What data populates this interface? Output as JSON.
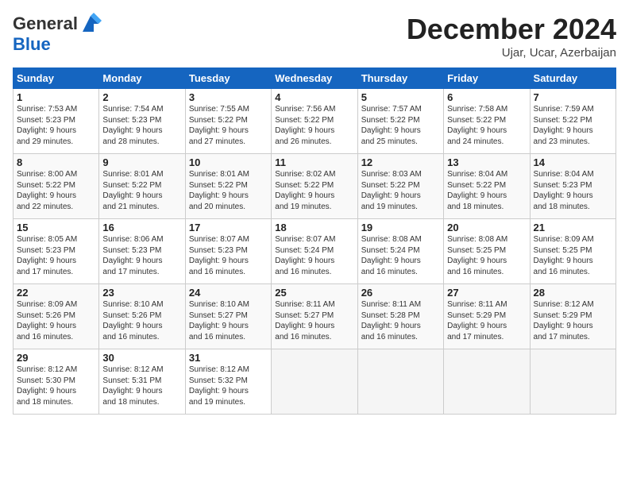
{
  "header": {
    "logo_line1": "General",
    "logo_line2": "Blue",
    "month": "December 2024",
    "location": "Ujar, Ucar, Azerbaijan"
  },
  "weekdays": [
    "Sunday",
    "Monday",
    "Tuesday",
    "Wednesday",
    "Thursday",
    "Friday",
    "Saturday"
  ],
  "weeks": [
    [
      {
        "day": "1",
        "info": "Sunrise: 7:53 AM\nSunset: 5:23 PM\nDaylight: 9 hours\nand 29 minutes."
      },
      {
        "day": "2",
        "info": "Sunrise: 7:54 AM\nSunset: 5:23 PM\nDaylight: 9 hours\nand 28 minutes."
      },
      {
        "day": "3",
        "info": "Sunrise: 7:55 AM\nSunset: 5:22 PM\nDaylight: 9 hours\nand 27 minutes."
      },
      {
        "day": "4",
        "info": "Sunrise: 7:56 AM\nSunset: 5:22 PM\nDaylight: 9 hours\nand 26 minutes."
      },
      {
        "day": "5",
        "info": "Sunrise: 7:57 AM\nSunset: 5:22 PM\nDaylight: 9 hours\nand 25 minutes."
      },
      {
        "day": "6",
        "info": "Sunrise: 7:58 AM\nSunset: 5:22 PM\nDaylight: 9 hours\nand 24 minutes."
      },
      {
        "day": "7",
        "info": "Sunrise: 7:59 AM\nSunset: 5:22 PM\nDaylight: 9 hours\nand 23 minutes."
      }
    ],
    [
      {
        "day": "8",
        "info": "Sunrise: 8:00 AM\nSunset: 5:22 PM\nDaylight: 9 hours\nand 22 minutes."
      },
      {
        "day": "9",
        "info": "Sunrise: 8:01 AM\nSunset: 5:22 PM\nDaylight: 9 hours\nand 21 minutes."
      },
      {
        "day": "10",
        "info": "Sunrise: 8:01 AM\nSunset: 5:22 PM\nDaylight: 9 hours\nand 20 minutes."
      },
      {
        "day": "11",
        "info": "Sunrise: 8:02 AM\nSunset: 5:22 PM\nDaylight: 9 hours\nand 19 minutes."
      },
      {
        "day": "12",
        "info": "Sunrise: 8:03 AM\nSunset: 5:22 PM\nDaylight: 9 hours\nand 19 minutes."
      },
      {
        "day": "13",
        "info": "Sunrise: 8:04 AM\nSunset: 5:22 PM\nDaylight: 9 hours\nand 18 minutes."
      },
      {
        "day": "14",
        "info": "Sunrise: 8:04 AM\nSunset: 5:23 PM\nDaylight: 9 hours\nand 18 minutes."
      }
    ],
    [
      {
        "day": "15",
        "info": "Sunrise: 8:05 AM\nSunset: 5:23 PM\nDaylight: 9 hours\nand 17 minutes."
      },
      {
        "day": "16",
        "info": "Sunrise: 8:06 AM\nSunset: 5:23 PM\nDaylight: 9 hours\nand 17 minutes."
      },
      {
        "day": "17",
        "info": "Sunrise: 8:07 AM\nSunset: 5:23 PM\nDaylight: 9 hours\nand 16 minutes."
      },
      {
        "day": "18",
        "info": "Sunrise: 8:07 AM\nSunset: 5:24 PM\nDaylight: 9 hours\nand 16 minutes."
      },
      {
        "day": "19",
        "info": "Sunrise: 8:08 AM\nSunset: 5:24 PM\nDaylight: 9 hours\nand 16 minutes."
      },
      {
        "day": "20",
        "info": "Sunrise: 8:08 AM\nSunset: 5:25 PM\nDaylight: 9 hours\nand 16 minutes."
      },
      {
        "day": "21",
        "info": "Sunrise: 8:09 AM\nSunset: 5:25 PM\nDaylight: 9 hours\nand 16 minutes."
      }
    ],
    [
      {
        "day": "22",
        "info": "Sunrise: 8:09 AM\nSunset: 5:26 PM\nDaylight: 9 hours\nand 16 minutes."
      },
      {
        "day": "23",
        "info": "Sunrise: 8:10 AM\nSunset: 5:26 PM\nDaylight: 9 hours\nand 16 minutes."
      },
      {
        "day": "24",
        "info": "Sunrise: 8:10 AM\nSunset: 5:27 PM\nDaylight: 9 hours\nand 16 minutes."
      },
      {
        "day": "25",
        "info": "Sunrise: 8:11 AM\nSunset: 5:27 PM\nDaylight: 9 hours\nand 16 minutes."
      },
      {
        "day": "26",
        "info": "Sunrise: 8:11 AM\nSunset: 5:28 PM\nDaylight: 9 hours\nand 16 minutes."
      },
      {
        "day": "27",
        "info": "Sunrise: 8:11 AM\nSunset: 5:29 PM\nDaylight: 9 hours\nand 17 minutes."
      },
      {
        "day": "28",
        "info": "Sunrise: 8:12 AM\nSunset: 5:29 PM\nDaylight: 9 hours\nand 17 minutes."
      }
    ],
    [
      {
        "day": "29",
        "info": "Sunrise: 8:12 AM\nSunset: 5:30 PM\nDaylight: 9 hours\nand 18 minutes."
      },
      {
        "day": "30",
        "info": "Sunrise: 8:12 AM\nSunset: 5:31 PM\nDaylight: 9 hours\nand 18 minutes."
      },
      {
        "day": "31",
        "info": "Sunrise: 8:12 AM\nSunset: 5:32 PM\nDaylight: 9 hours\nand 19 minutes."
      },
      null,
      null,
      null,
      null
    ]
  ]
}
